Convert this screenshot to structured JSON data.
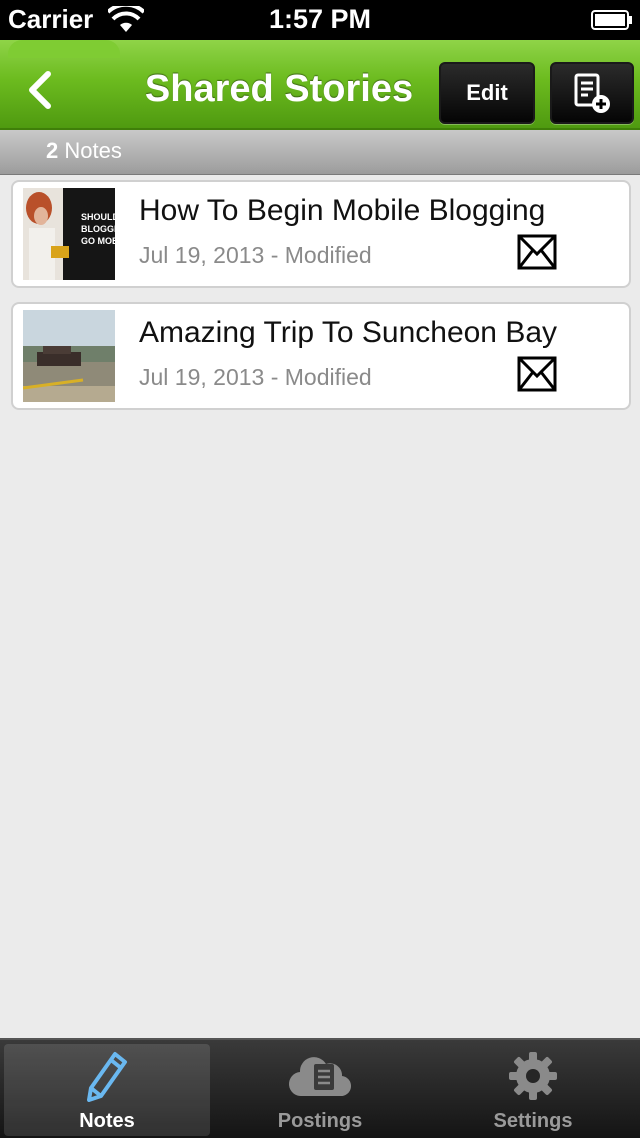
{
  "status": {
    "carrier": "Carrier",
    "time": "1:57 PM"
  },
  "nav": {
    "title": "Shared Stories",
    "edit_label": "Edit"
  },
  "count": {
    "number": "2",
    "label": "Notes"
  },
  "notes": [
    {
      "title": "How To Begin Mobile Blogging",
      "date": "Jul 19, 2013 - Modified",
      "thumb_text": [
        "SHOULD",
        "BLOGGER",
        "GO MOBI"
      ]
    },
    {
      "title": "Amazing Trip To Suncheon Bay",
      "date": "Jul 19, 2013 - Modified"
    }
  ],
  "tabs": [
    {
      "label": "Notes",
      "icon": "pencil-icon",
      "active": true
    },
    {
      "label": "Postings",
      "icon": "cloud-document-icon",
      "active": false
    },
    {
      "label": "Settings",
      "icon": "gear-icon",
      "active": false
    }
  ],
  "colors": {
    "nav_green": "#6cbb1f",
    "background": "#ebebeb",
    "tab_bar": "#1e1e1e"
  }
}
